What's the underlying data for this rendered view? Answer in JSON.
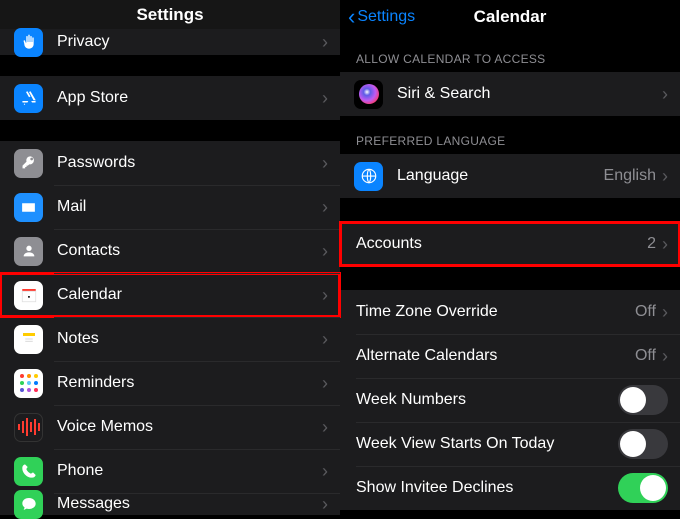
{
  "left": {
    "title": "Settings",
    "rows_a": [
      {
        "icon": "hand-icon",
        "label": "Privacy"
      }
    ],
    "rows_b": [
      {
        "icon": "appstore-icon",
        "label": "App Store"
      }
    ],
    "rows_c": [
      {
        "icon": "key-icon",
        "label": "Passwords"
      },
      {
        "icon": "mail-icon",
        "label": "Mail"
      },
      {
        "icon": "contacts-icon",
        "label": "Contacts"
      },
      {
        "icon": "calendar-icon",
        "label": "Calendar",
        "highlight": true
      },
      {
        "icon": "notes-icon",
        "label": "Notes"
      },
      {
        "icon": "reminders-icon",
        "label": "Reminders"
      },
      {
        "icon": "voicememos-icon",
        "label": "Voice Memos"
      },
      {
        "icon": "phone-icon",
        "label": "Phone"
      },
      {
        "icon": "messages-icon",
        "label": "Messages"
      }
    ]
  },
  "right": {
    "back": "Settings",
    "title": "Calendar",
    "section_access": "ALLOW CALENDAR TO ACCESS",
    "siri_label": "Siri & Search",
    "section_lang": "PREFERRED LANGUAGE",
    "language_label": "Language",
    "language_value": "English",
    "accounts_label": "Accounts",
    "accounts_value": "2",
    "options": [
      {
        "label": "Time Zone Override",
        "value": "Off",
        "type": "disclosure"
      },
      {
        "label": "Alternate Calendars",
        "value": "Off",
        "type": "disclosure"
      },
      {
        "label": "Week Numbers",
        "type": "toggle",
        "on": false
      },
      {
        "label": "Week View Starts On Today",
        "type": "toggle",
        "on": false
      },
      {
        "label": "Show Invitee Declines",
        "type": "toggle",
        "on": true
      }
    ]
  }
}
